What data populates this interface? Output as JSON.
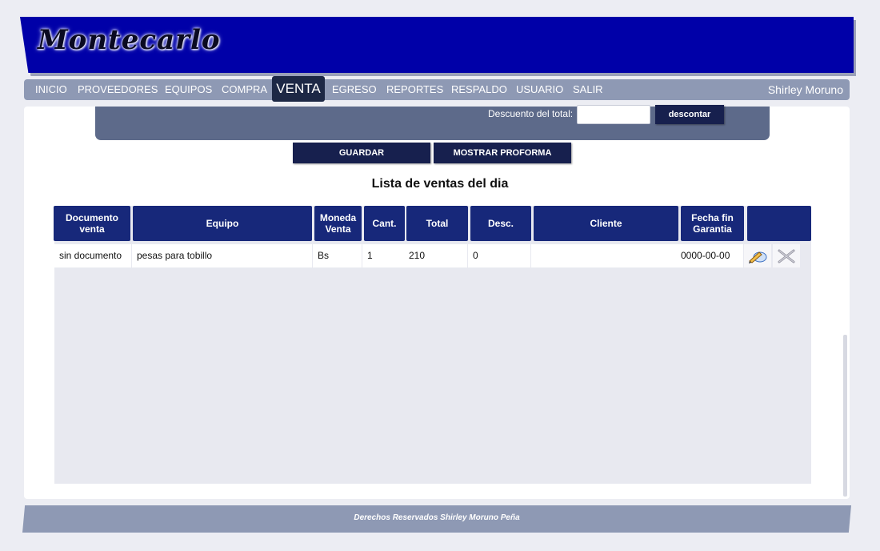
{
  "header": {
    "logo_text": "Montecarlo"
  },
  "nav": {
    "items": [
      "INICIO",
      "PROVEEDORES",
      "EQUIPOS",
      "COMPRA",
      "VENTA",
      "EGRESO",
      "REPORTES",
      "RESPALDO",
      "USUARIO",
      "SALIR"
    ],
    "active": "VENTA",
    "user": "Shirley Moruno"
  },
  "discount": {
    "label": "Descuento del total:",
    "input_value": "",
    "button_label": "descontar"
  },
  "actions": {
    "save_label": "GUARDAR",
    "proforma_label": "MOSTRAR PROFORMA"
  },
  "list": {
    "title": "Lista de ventas del dia",
    "headers": {
      "documento": "Documento venta",
      "equipo": "Equipo",
      "moneda": "Moneda Venta",
      "cant": "Cant.",
      "total": "Total",
      "desc": "Desc.",
      "cliente": "Cliente",
      "garantia": "Fecha fin Garantia",
      "acciones": ""
    },
    "rows": [
      {
        "documento": "sin documento",
        "equipo": "pesas para tobillo",
        "moneda": "Bs",
        "cant": "1",
        "total": "210",
        "desc": "0",
        "cliente": "",
        "garantia": "0000-00-00"
      }
    ]
  },
  "icons": {
    "edit": "edit-pencil-icon",
    "delete": "delete-x-icon"
  },
  "footer": {
    "text": "Derechos Reservados Shirley Moruno Peña"
  },
  "colors": {
    "banner": "#0000a8",
    "nav": "#8e99b4",
    "header_cell": "#17287a",
    "button": "#17204e"
  }
}
